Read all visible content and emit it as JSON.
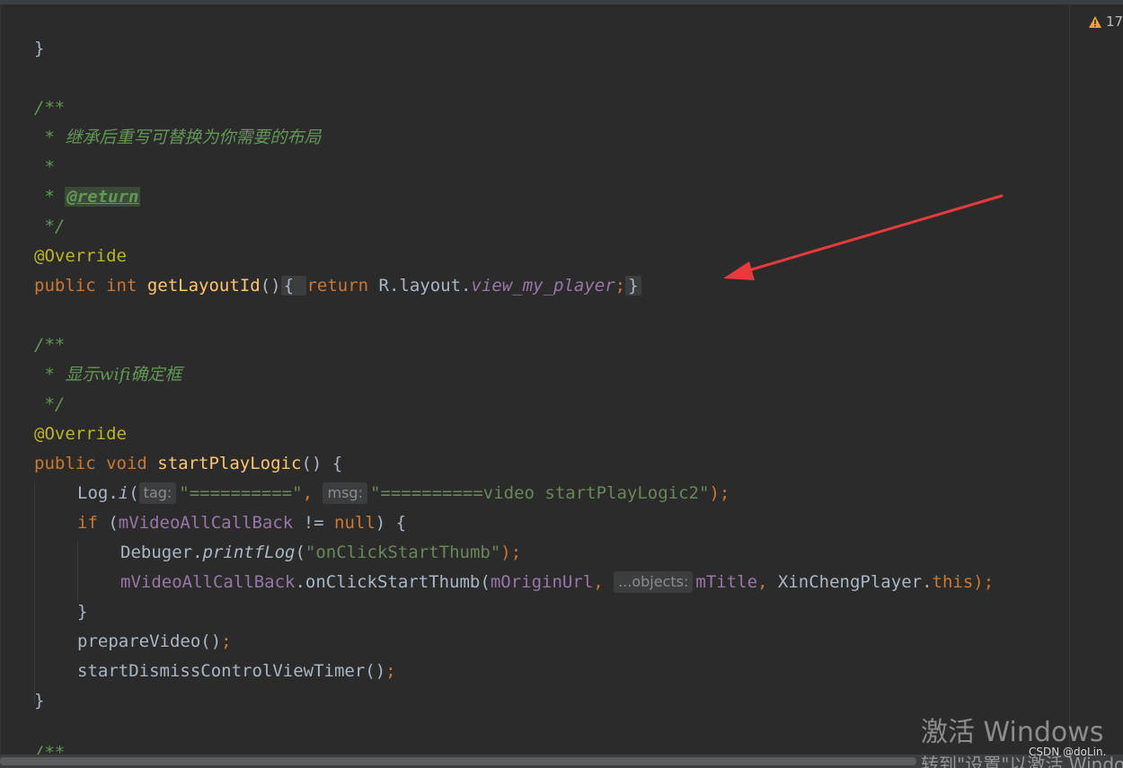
{
  "editor": {
    "warning_count": "17",
    "lines": {
      "l1": "}",
      "l2": "/**",
      "l3_star": " * ",
      "l3_text": "继承后重写可替换为你需要的布局",
      "l4": " *",
      "l5_star": " * ",
      "l5_tag": "@return",
      "l6": " */",
      "l7": "@Override",
      "l8_public": "public ",
      "l8_int": "int ",
      "l8_name": "getLayoutId",
      "l8_parens": "()",
      "l8_open": "{ ",
      "l8_return": "return ",
      "l8_rlayout": "R.layout.",
      "l8_field": "view_my_player",
      "l8_semi": ";",
      "l8_close": "}",
      "l9": "/**",
      "l10_star": " * ",
      "l10_text": "显示wifi确定框",
      "l11": " */",
      "l12": "@Override",
      "l13_public": "public ",
      "l13_void": "void ",
      "l13_name": "startPlayLogic",
      "l13_rest": "() {",
      "l14_log": "Log.",
      "l14_i": "i",
      "l14_open": "(",
      "l14_hint1": "tag:",
      "l14_str1": "\"==========\"",
      "l14_comma": ",",
      "l14_hint2": "msg:",
      "l14_str2": "\"==========video startPlayLogic2\"",
      "l14_close": ");",
      "l15_if": "if ",
      "l15_open": "(",
      "l15_field": "mVideoAllCallBack",
      "l15_ne": " != ",
      "l15_null": "null",
      "l15_close": ") {",
      "l16_cls": "Debuger.",
      "l16_method": "printfLog",
      "l16_open": "(",
      "l16_str": "\"onClickStartThumb\"",
      "l16_close": ");",
      "l17_field": "mVideoAllCallBack",
      "l17_call": ".onClickStartThumb(",
      "l17_arg1": "mOriginUrl",
      "l17_comma1": ", ",
      "l17_hint": "...objects:",
      "l17_arg2": "mTitle",
      "l17_comma2": ", ",
      "l17_cls": "XinChengPlayer.",
      "l17_this": "this",
      "l17_close": ");",
      "l18": "}",
      "l19_call": "prepareVideo()",
      "l19_semi": ";",
      "l20_call": "startDismissControlViewTimer()",
      "l20_semi": ";",
      "l21": "}",
      "l22": "/**"
    }
  },
  "annotation_arrow": {
    "color": "#e83a3a"
  },
  "watermark": {
    "line1": "激活 Windows",
    "line2": "转到\"设置\"以激活 Windows。",
    "csdn": "CSDN @doLin."
  },
  "colors": {
    "background": "#2b2b2b",
    "keyword": "#cc7832",
    "function": "#ffc66d",
    "annotation": "#bbb529",
    "string": "#6a8759",
    "field": "#9876aa",
    "doc_comment": "#629755",
    "default_text": "#a9b7c6"
  }
}
